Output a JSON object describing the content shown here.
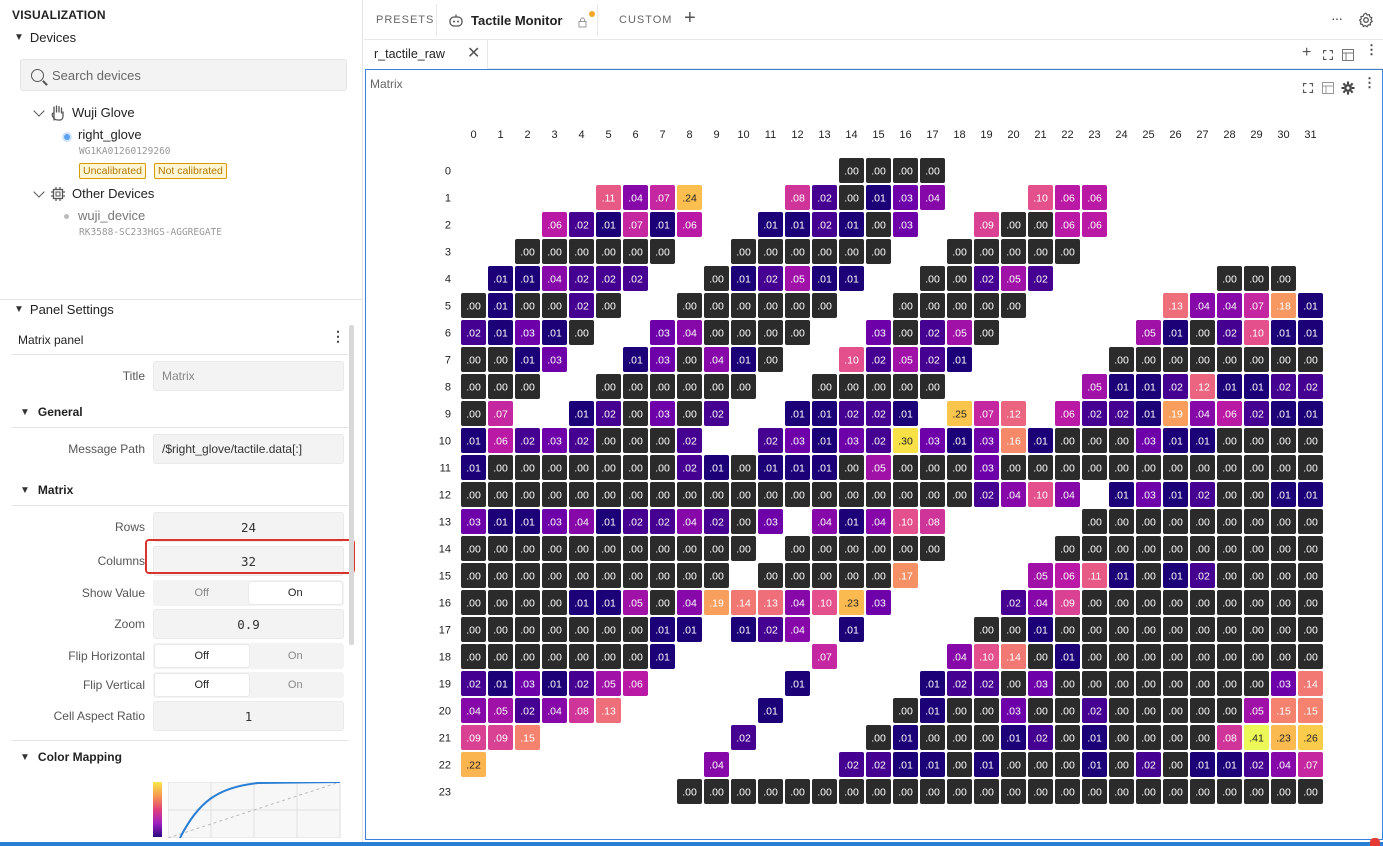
{
  "sidebar": {
    "title": "VISUALIZATION",
    "devices_header": "Devices",
    "search_placeholder": "Search devices",
    "group1": {
      "name": "Wuji Glove",
      "device": "right_glove",
      "serial": "WG1KA01260129260",
      "badges": [
        "Uncalibrated",
        "Not calibrated"
      ]
    },
    "group2": {
      "name": "Other Devices",
      "device": "wuji_device",
      "serial": "RK3588-SC233HGS-AGGREGATE"
    },
    "panel_settings_header": "Panel Settings",
    "panel_name": "Matrix panel",
    "title_label": "Title",
    "title_placeholder": "Matrix",
    "general_header": "General",
    "message_path_label": "Message Path",
    "message_path": "/$right_glove/tactile.data[:]",
    "matrix_header": "Matrix",
    "rows_label": "Rows",
    "rows": "24",
    "columns_label": "Columns",
    "columns": "32",
    "show_value_label": "Show Value",
    "zoom_label": "Zoom",
    "zoom": "0.9",
    "flip_h_label": "Flip Horizontal",
    "flip_v_label": "Flip Vertical",
    "aspect_label": "Cell Aspect Ratio",
    "aspect": "1",
    "off": "Off",
    "on": "On",
    "show_value": "On",
    "flip_h": "Off",
    "flip_v": "Off",
    "color_mapping_header": "Color Mapping"
  },
  "tabs": {
    "presets": "PRESETS",
    "active": "Tactile Monitor",
    "custom": "CUSTOM"
  },
  "file_tab": "r_tactile_raw",
  "panel": {
    "title": "Matrix"
  },
  "colors": {
    "accent": "#3b82d6",
    "empty": "#2a2a2a",
    "badge": "#d89a00"
  },
  "matrix": {
    "cols": [
      "0",
      "1",
      "2",
      "3",
      "4",
      "5",
      "6",
      "7",
      "8",
      "9",
      "10",
      "11",
      "12",
      "13",
      "14",
      "15",
      "16",
      "17",
      "18",
      "19",
      "20",
      "21",
      "22",
      "23",
      "24",
      "25",
      "26",
      "27",
      "28",
      "29",
      "30",
      "31"
    ],
    "rows": [
      "0",
      "1",
      "2",
      "3",
      "4",
      "5",
      "6",
      "7",
      "8",
      "9",
      "10",
      "11",
      "12",
      "13",
      "14",
      "15",
      "16",
      "17",
      "18",
      "19",
      "20",
      "21",
      "22",
      "23"
    ],
    "data": [
      "..............................................",
      "",
      "",
      "",
      "",
      "",
      "",
      "",
      "",
      "",
      "",
      "",
      "",
      "",
      "",
      "",
      "",
      "",
      "",
      "",
      "",
      "",
      "",
      ""
    ],
    "cells": [
      "_,_,_,_,_,_,_,_,_,_,_,_,_,_,.00,.00,.00,.00,_,_,_,_,_,_,_,_,_,_,_,_,_,_",
      "_,_,_,_,_,.11,.04,.07,.24,_,_,_,.08,.02,.00,.01,.03,.04,_,_,_,.10,.06,.06,_,_,_,_,_,_,_,_",
      "_,_,_,.06,.02,.01,.07,.01,.06,_,_,.01,.01,.02,.01,.00,.03,_,_,.09,.00,.00,.06,.06,_,_,_,_,_,_,_,_",
      "_,_,.00,.00,.00,.00,.00,.00,_,_,.00,.00,.00,.00,.00,.00,_,_,.00,.00,.00,.00,.00,_,_,_,_,_,_,_,_,_",
      "_,.01,.01,.04,.02,.02,.02,_,_,.00,.01,.02,.05,.01,.01,_,_,.00,.00,.02,.05,.02,_,_,_,_,_,_,.00,.00,.00,_",
      ".00,.01,.00,.00,.02,.00,_,_,.00,.00,.00,.00,.00,.00,_,_,.00,.00,.00,.00,.00,_,_,_,_,_,.13,.04,.04,.07,.18,.01",
      ".02,.01,.03,.01,.00,_,_,.03,.04,.00,.00,.00,.00,_,_,.03,.00,.02,.05,.00,_,_,_,_,_,.05,.01,.00,.02,.10,.01,.01",
      ".00,.00,.01,.03,_,_,.01,.03,.00,.04,.01,.00,_,_,.10,.02,.05,.02,.01,_,_,_,_,_,.00,.00,.00,.00,.00,.00,.00,.00",
      ".00,.00,.00,_,_,.00,.00,.00,.00,.00,.00,_,_,.00,.00,.00,.00,.00,_,_,_,_,_,.05,.01,.01,.02,.12,.01,.01,.02,.02",
      ".00,.07,_,_,.01,.02,.00,.03,.00,.02,_,_,.01,.01,.02,.02,.01,_,.25,.07,.12,_,.06,.02,.02,.01,.19,.04,.06,.02,.01,.01",
      ".01,.06,.02,.03,.02,.00,.00,.00,.02,_,_,.02,.03,.01,.03,.02,.30,.03,.01,.03,.16,.01,.00,.00,.00,.03,.01,.01,.00,.00,.00,.00",
      ".01,.00,.00,.00,.00,.00,.00,.00,.02,.01,.00,.01,.01,.01,.00,.05,.00,.00,.00,.03,.00,.00,.00,.00,.00,.00,.00,.00,.00,.00,.00,.00",
      ".00,.00,.00,.00,.00,.00,.00,.00,.00,.00,.00,.00,.00,.00,.00,.00,.00,.00,.00,.02,.04,.10,.04,_,.01,.03,.01,.02,.00,.00,.01,.01",
      ".03,.01,.01,.03,.04,.01,.02,.02,.04,.02,.00,.03,_,.04,.01,.04,.10,.08,_,_,_,_,_,.00,.00,.00,.00,.00,.00,.00,.00,.00",
      ".00,.00,.00,.00,.00,.00,.00,.00,.00,.00,.00,_,.00,.00,.00,.00,.00,.00,_,_,_,_,.00,.00,.00,.00,.00,.00,.00,.00,.00,.00",
      ".00,.00,.00,.00,.00,.00,.00,.00,.00,.00,_,.00,.00,.00,.00,.00,.17,_,_,_,_,.05,.06,.11,.01,.00,.01,.02,.00,.00,.00,.00",
      ".00,.00,.00,.00,.01,.01,.05,.00,.04,.19,.14,.13,.04,.10,.23,.03,_,_,_,_,.02,.04,.09,.00,.00,.00,.00,.00,.00,.00,.00,.00",
      ".00,.00,.00,.00,.00,.00,.00,.01,.01,_,.01,.02,.04,_,.01,_,_,_,_,.00,.00,.01,.00,.00,.00,.00,.00,.00,.00,.00,.00,.00",
      ".00,.00,.00,.00,.00,.00,.00,.01,_,_,_,_,_,.07,_,_,_,_,.04,.10,.14,.00,.01,.00,.00,.00,.00,.00,.00,.00,.00,.00",
      ".02,.01,.03,.01,.02,.05,.06,_,_,_,_,_,.01,_,_,_,_,.01,.02,.02,.00,.03,.00,.00,.00,.00,.00,.00,.00,.00,.03,.14",
      ".04,.05,.02,.04,.08,.13,_,_,_,_,_,.01,_,_,_,_,.00,.01,.00,.00,.03,.00,.00,.02,.00,.00,.00,.00,.00,.05,.15,.15",
      ".09,.09,.15,_,_,_,_,_,_,_,.02,_,_,_,_,.00,.01,.00,.00,.00,.01,.02,.00,.01,.00,.00,.00,.00,.08,.41,.23,.26",
      ".22,_,_,_,_,_,_,_,_,.04,_,_,_,_,.02,.02,.01,.01,.00,.01,.00,.00,.00,.01,.00,.02,.00,.01,.01,.02,.04,.07",
      "_,_,_,_,_,_,_,_,.00,.00,.00,.00,.00,.00,.00,.00,.00,.00,.00,.00,.00,.00,.00,.00,.00,.00,.00,.00,.00,.00,.00,.00"
    ]
  }
}
